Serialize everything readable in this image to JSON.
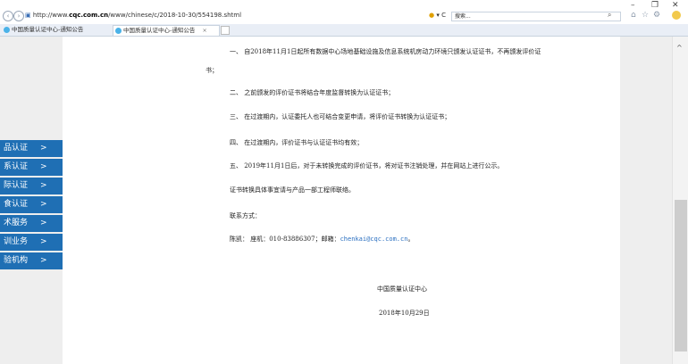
{
  "browser": {
    "url_prefix": "http://www.",
    "url_domain": "cqc.com.cn",
    "url_path": "/www/chinese/c/2018-10-30/554198.shtml",
    "refresh_glyph": "▾ C",
    "search_placeholder": "搜索...",
    "tabs": [
      {
        "label": "中国质量认证中心-通知公告"
      },
      {
        "label": "中国质量认证中心-通知公告",
        "close": "×"
      }
    ]
  },
  "sidebar": {
    "items": [
      {
        "label": "品认证",
        "arrow": ">"
      },
      {
        "label": "系认证",
        "arrow": ">"
      },
      {
        "label": "际认证",
        "arrow": ">"
      },
      {
        "label": "食认证",
        "arrow": ">"
      },
      {
        "label": "术服务",
        "arrow": ">"
      },
      {
        "label": "训业务",
        "arrow": ">"
      },
      {
        "label": "验机构",
        "arrow": ">"
      }
    ]
  },
  "article": {
    "p1a": "一、 自2018年11月1日起所有数据中心场地基础设施及信息系统机房动力环境只颁发认证证书，不再颁发评价证",
    "p1b": "书；",
    "p2": "二、 之前颁发的评价证书将结合年度监督转换为认证证书；",
    "p3": "三、 在过渡期内，认证委托人也可结合变更申请，将评价证书转换为认证证书；",
    "p4": "四、 在过渡期内，评价证书与认证证书均有效；",
    "p5": "五、 2019年11月1日后，对于未转换完成的评价证书，将对证书注销处理，并在网站上进行公示。",
    "p6": "证书转换具体事宜请与产品一部工程师联络。",
    "p7": "联系方式：",
    "contact_prefix": "陈凯：  座机：010-83886307；邮箱：",
    "email": "chenkai@cqc.com.cn",
    "contact_suffix": "。",
    "org": "中国质量认证中心",
    "date": "2018年10月29日"
  },
  "colors": {
    "sidebar_bg": "#1f6fb4",
    "link": "#2a6fc0"
  }
}
